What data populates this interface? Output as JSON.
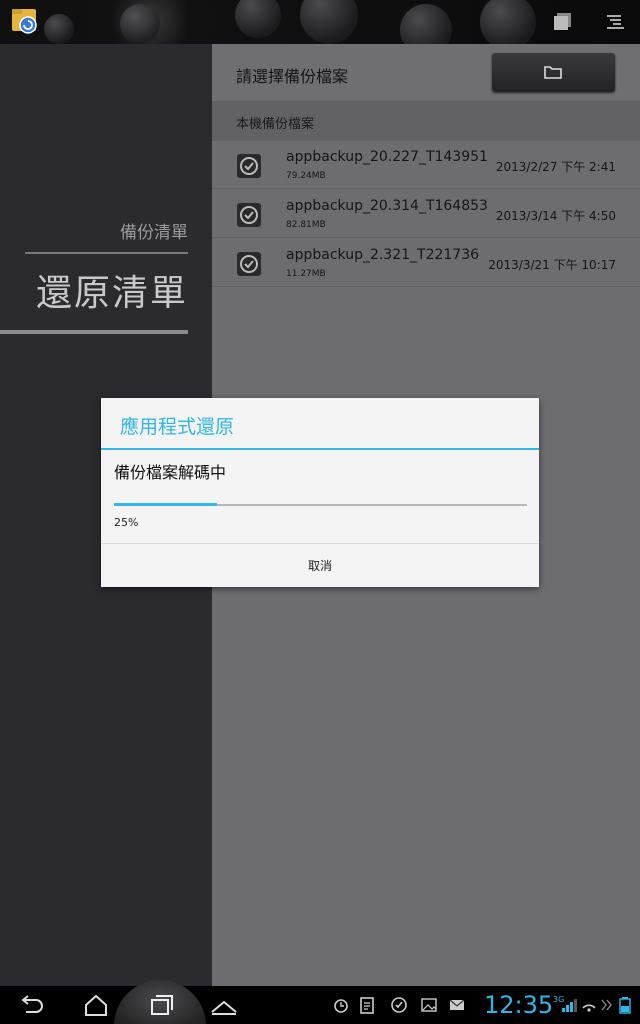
{
  "header": {
    "title": "請選擇備份檔案",
    "folder_icon": "folder-icon"
  },
  "sidebar": {
    "items": [
      {
        "label": "備份清單"
      },
      {
        "label": "還原清單"
      }
    ]
  },
  "file_list": {
    "section_title": "本機備份檔案",
    "files": [
      {
        "name": "appbackup_20.227_T143951",
        "size": "79.24MB",
        "date": "2013/2/27 下午 2:41"
      },
      {
        "name": "appbackup_20.314_T164853",
        "size": "82.81MB",
        "date": "2013/3/14 下午 4:50"
      },
      {
        "name": "appbackup_2.321_T221736",
        "size": "11.27MB",
        "date": "2013/3/21 下午 10:17"
      }
    ]
  },
  "dialog": {
    "title": "應用程式還原",
    "message": "備份檔案解碼中",
    "progress": 0.25,
    "progress_text": "25%",
    "cancel_label": "取消"
  },
  "statusbar": {
    "time": "12:35",
    "network": "3G"
  },
  "colors": {
    "accent": "#33b5e5",
    "sidebar_bg": "#2b2b2f",
    "content_bg": "#6d6d70"
  }
}
